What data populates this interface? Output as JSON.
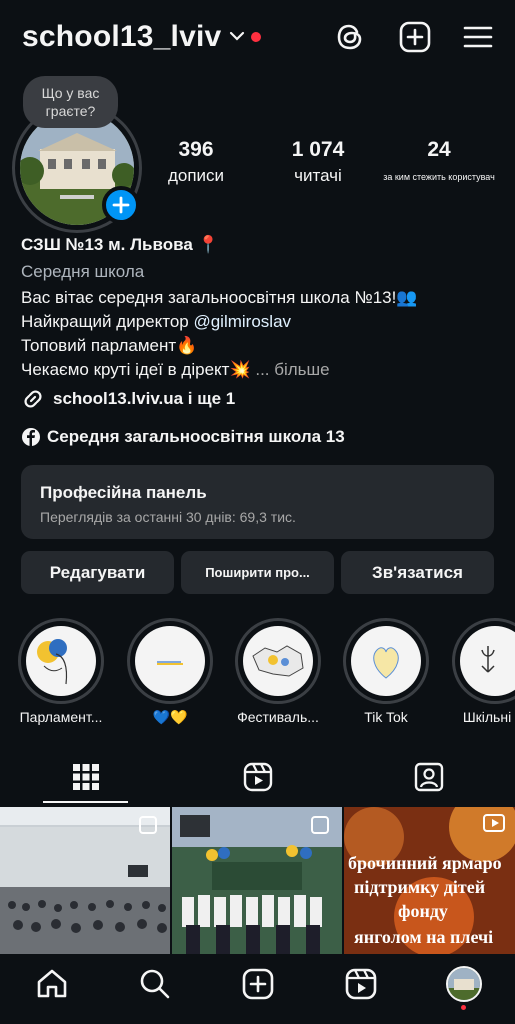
{
  "header": {
    "username": "school13_lviv",
    "icons": [
      "chevron-down-icon",
      "threads-icon",
      "create-icon",
      "menu-icon"
    ]
  },
  "note": {
    "text": "Що у вас граєте?"
  },
  "note_display": {
    "line1": "Що у вас",
    "line2": "граєте?"
  },
  "stats": [
    {
      "value": "396",
      "label": "дописи"
    },
    {
      "value": "1 074",
      "label": "читачі"
    },
    {
      "value": "24",
      "label": "за ким стежить користувач"
    }
  ],
  "bio": {
    "name": "СЗШ №13 м. Львова 📍",
    "category": "Середня школа",
    "line1": "Вас вітає середня загальноосвітня школа №13!👥",
    "line2_prefix": "Найкращий директор ",
    "line2_mention": "@gilmiroslav",
    "line3": "Топовий парламент🔥",
    "line4": "Чекаємо круті ідеї в дірект💥",
    "more": "... більше",
    "link": "school13.lviv.ua і ще 1",
    "facebook": "Середня загальноосвітня школа 13"
  },
  "panel": {
    "title": "Професійна панель",
    "subtitle": "Переглядів за останні 30 днів: 69,3 тис."
  },
  "buttons": {
    "edit": "Редагувати",
    "share": "Поширити про...",
    "contact": "Зв'язатися"
  },
  "highlights": [
    {
      "label": "Парламент..."
    },
    {
      "label": "💙💛"
    },
    {
      "label": "Фестиваль..."
    },
    {
      "label": "Tik Tok"
    },
    {
      "label": "Шкільні гу"
    }
  ],
  "posts": [
    {
      "kind": "carousel"
    },
    {
      "kind": "carousel"
    },
    {
      "kind": "reel",
      "text": "брочинний ярмаро підтримку дітей фонду янголом на плечі"
    }
  ],
  "post_text_lines": [
    "брочинний ярмаро",
    "підтримку дітей",
    "фонду",
    "янголом на плечі"
  ],
  "bottom_nav": [
    "home-icon",
    "search-icon",
    "create-icon",
    "reels-icon",
    "profile-avatar"
  ],
  "colors": {
    "accent": "#0095f6",
    "background": "#0c1014",
    "card": "#25292e",
    "notify": "#ff3040"
  }
}
